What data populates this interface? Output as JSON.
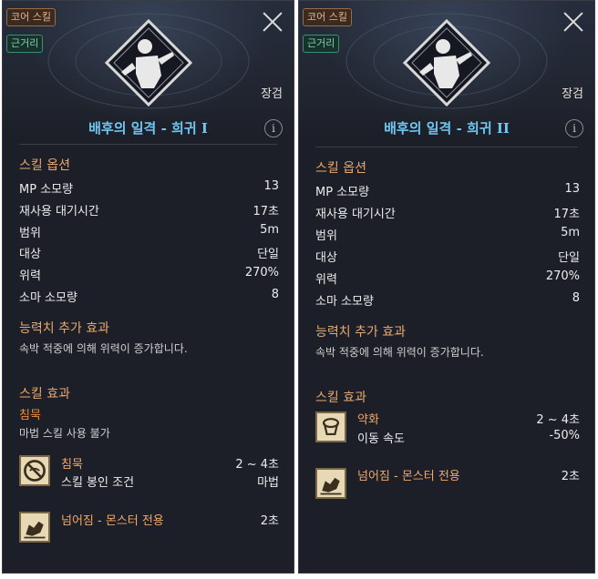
{
  "panels": [
    {
      "tags": {
        "core": "코어 스킬",
        "range": "근거리"
      },
      "weapon": "장검",
      "title": "배후의 일격 - 희귀 I",
      "info_glyph": "i",
      "options": {
        "heading": "스킬 옵션",
        "rows": [
          {
            "label": "MP 소모량",
            "value": "13"
          },
          {
            "label": "재사용 대기시간",
            "value": "17초"
          },
          {
            "label": "범위",
            "value": "5m"
          },
          {
            "label": "대상",
            "value": "단일"
          },
          {
            "label": "위력",
            "value": "270%"
          },
          {
            "label": "소마 소모량",
            "value": "8"
          }
        ]
      },
      "stat_bonus": {
        "heading": "능력치 추가 효과",
        "text": "속박 적중에 의해 위력이 증가합니다."
      },
      "effects": {
        "heading": "스킬 효과",
        "status_name": "침묵",
        "status_desc": "마법 스킬 사용 불가",
        "items": [
          {
            "icon": "silence-icon",
            "name": "침묵",
            "duration": "2 ~ 4초",
            "sub_label": "스킬 봉인 조건",
            "sub_value": "마법"
          },
          {
            "icon": "knockdown-icon",
            "name": "넘어짐 - 몬스터 전용",
            "duration": "2초"
          }
        ]
      }
    },
    {
      "tags": {
        "core": "코어 스킬",
        "range": "근거리"
      },
      "weapon": "장검",
      "title": "배후의 일격 - 희귀 II",
      "info_glyph": "i",
      "options": {
        "heading": "스킬 옵션",
        "rows": [
          {
            "label": "MP 소모량",
            "value": "13"
          },
          {
            "label": "재사용 대기시간",
            "value": "17초"
          },
          {
            "label": "범위",
            "value": "5m"
          },
          {
            "label": "대상",
            "value": "단일"
          },
          {
            "label": "위력",
            "value": "270%"
          },
          {
            "label": "소마 소모량",
            "value": "8"
          }
        ]
      },
      "stat_bonus": {
        "heading": "능력치 추가 효과",
        "text": "속박 적중에 의해 위력이 증가합니다."
      },
      "effects": {
        "heading": "스킬 효과",
        "items": [
          {
            "icon": "weaken-icon",
            "name": "약화",
            "duration": "2 ~ 4초",
            "sub_label": "이동 속도",
            "sub_value": "-50%"
          },
          {
            "icon": "knockdown-icon",
            "name": "넘어짐 - 몬스터 전용",
            "duration": "2초"
          }
        ]
      }
    }
  ],
  "colors": {
    "panel_bg": "#1c1f27",
    "title": "#6fc7f2",
    "section": "#e8a86e",
    "status": "#f08a3c"
  }
}
